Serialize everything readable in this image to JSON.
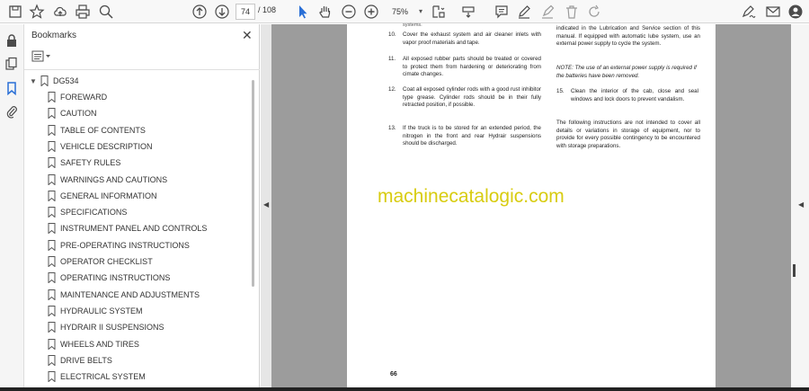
{
  "toolbar": {
    "page_current": "74",
    "page_total": "/ 108",
    "zoom": "75%"
  },
  "bookmarks_panel": {
    "title": "Bookmarks",
    "root": "DG534",
    "items": [
      "FOREWARD",
      "CAUTION",
      "TABLE OF CONTENTS",
      "VEHICLE DESCRIPTION",
      "SAFETY RULES",
      "WARNINGS AND CAUTIONS",
      "GENERAL INFORMATION",
      "SPECIFICATIONS",
      "INSTRUMENT PANEL AND CONTROLS",
      "PRE-OPERATING INSTRUCTIONS",
      "OPERATOR CHECKLIST",
      "OPERATING INSTRUCTIONS",
      "MAINTENANCE AND ADJUSTMENTS",
      "HYDRAULIC SYSTEM",
      "HYDRAIR II SUSPENSIONS",
      "WHEELS AND TIRES",
      "DRIVE BELTS",
      "ELECTRICAL SYSTEM"
    ]
  },
  "document": {
    "left_top_fragment": "systems.",
    "left_items": [
      {
        "num": "10.",
        "text": "Cover the exhaust system and air cleaner inlets with vapor proof materials and tape."
      },
      {
        "num": "11.",
        "text": "All exposed rubber parts should be treated or covered to protect them from hardening or deteriorating from cimate changes."
      },
      {
        "num": "12.",
        "text": "Coat all exposed cylinder rods with a good rust inhibitor type grease. Cylinder rods should be in their fully retracted position, if possible."
      },
      {
        "num": "13.",
        "text": "If the truck is to be stored for an extended period, the nitrogen in the front and rear Hydrair suspensions should be discharged."
      }
    ],
    "right_top": "indicated in the Lubrication and Service section of this manual. If equipped with automatic lube system, use an external power supply to cycle the system.",
    "right_note": "NOTE: The use of an external power supply is required if the batteries have been removed.",
    "right_item": {
      "num": "15.",
      "text": "Clean the interior of the cab, close and seal windows and lock doors to prevent vandalism."
    },
    "right_paragraph": "The following instructions are not intended to cover all details or variations in storage of equipment, nor to provide for every possible contingency to be encountered with storage preparations.",
    "watermark": "machinecatalogic.com",
    "page_number": "66"
  }
}
